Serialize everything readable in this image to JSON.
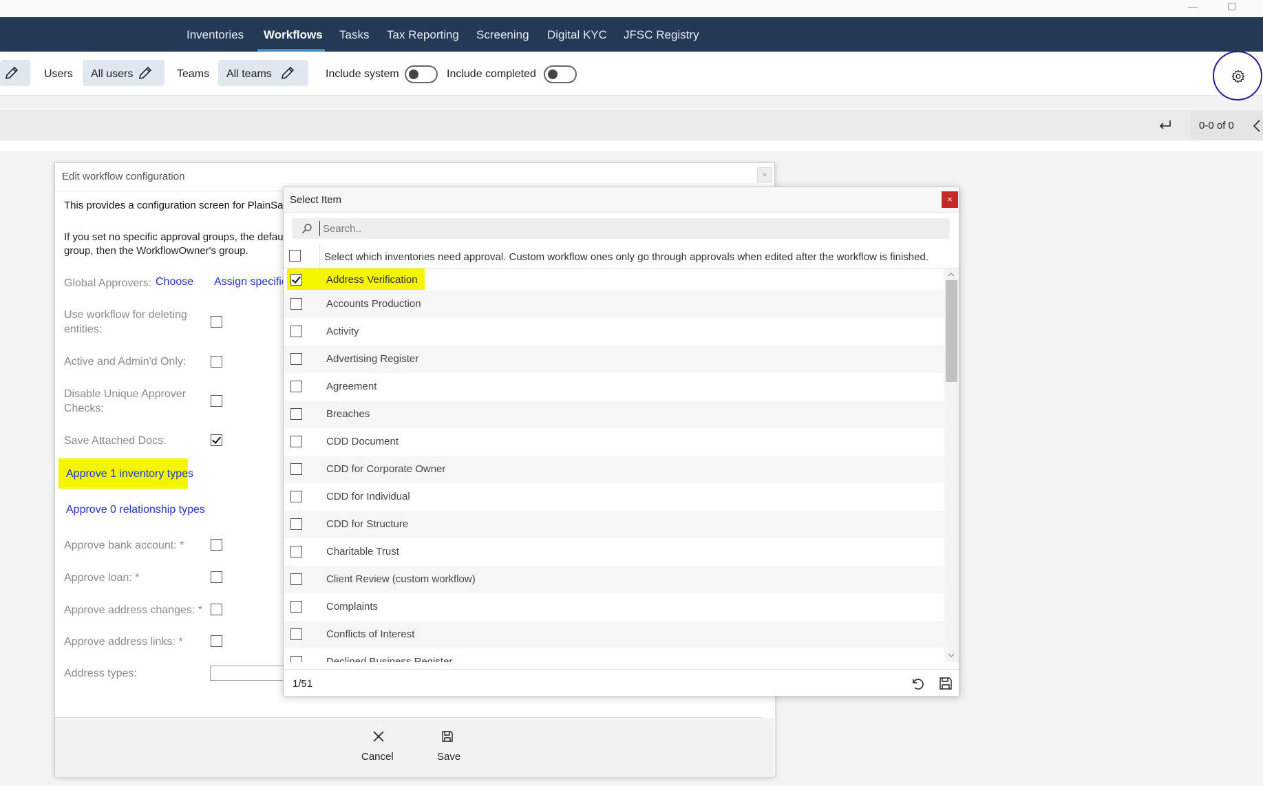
{
  "nav": {
    "items": [
      "Inventories",
      "Workflows",
      "Tasks",
      "Tax Reporting",
      "Screening",
      "Digital KYC",
      "JFSC Registry"
    ],
    "active": "Workflows"
  },
  "filters": {
    "users_label": "Users",
    "users_value": "All users",
    "teams_label": "Teams",
    "teams_value": "All teams",
    "include_system": "Include system",
    "include_completed": "Include completed"
  },
  "pager": {
    "text": "0-0 of 0"
  },
  "edit_dialog": {
    "title": "Edit workflow configuration",
    "close": "×",
    "description": "This provides a configuration screen for PlainSa",
    "note": "If you set no specific approval groups, the defau group, then the WorkflowOwner's group.",
    "global_approvers_label": "Global Approvers:",
    "choose_link": "Choose",
    "assign_link": "Assign specific",
    "fields": [
      {
        "label": "Use workflow for deleting entities:",
        "checked": false
      },
      {
        "label": "Active and Admin'd Only:",
        "checked": false
      },
      {
        "label": "Disable Unique Approver Checks:",
        "checked": false
      },
      {
        "label": "Save Attached Docs:",
        "checked": true
      }
    ],
    "approve_inventory": "Approve 1 inventory types",
    "approve_relationship": "Approve 0 relationship types",
    "fields2": [
      {
        "label": "Approve bank account: *",
        "checked": false
      },
      {
        "label": "Approve loan: *",
        "checked": false
      },
      {
        "label": "Approve address changes: *",
        "checked": false
      },
      {
        "label": "Approve address links: *",
        "checked": false
      }
    ],
    "address_types_label": "Address types:",
    "cancel": "Cancel",
    "save": "Save"
  },
  "select_dialog": {
    "title": "Select Item",
    "close": "×",
    "search_placeholder": "Search..",
    "header_text": "Select which inventories need approval. Custom workflow ones only go through approvals when edited after the workflow is finished.",
    "items": [
      {
        "label": "Address Verification",
        "checked": true
      },
      {
        "label": "Accounts Production",
        "checked": false
      },
      {
        "label": "Activity",
        "checked": false
      },
      {
        "label": "Advertising Register",
        "checked": false
      },
      {
        "label": "Agreement",
        "checked": false
      },
      {
        "label": "Breaches",
        "checked": false
      },
      {
        "label": "CDD Document",
        "checked": false
      },
      {
        "label": "CDD for Corporate Owner",
        "checked": false
      },
      {
        "label": "CDD for Individual",
        "checked": false
      },
      {
        "label": "CDD for Structure",
        "checked": false
      },
      {
        "label": "Charitable Trust",
        "checked": false
      },
      {
        "label": "Client Review (custom workflow)",
        "checked": false
      },
      {
        "label": "Complaints",
        "checked": false
      },
      {
        "label": "Conflicts of Interest",
        "checked": false
      },
      {
        "label": "Declined Business Register",
        "checked": false
      }
    ],
    "count": "1/51"
  },
  "colors": {
    "nav_bg": "#233955",
    "highlight": "#f5f500",
    "link": "#2233cc",
    "close_red": "#c62828",
    "gear_ring": "#2b1b9a"
  }
}
